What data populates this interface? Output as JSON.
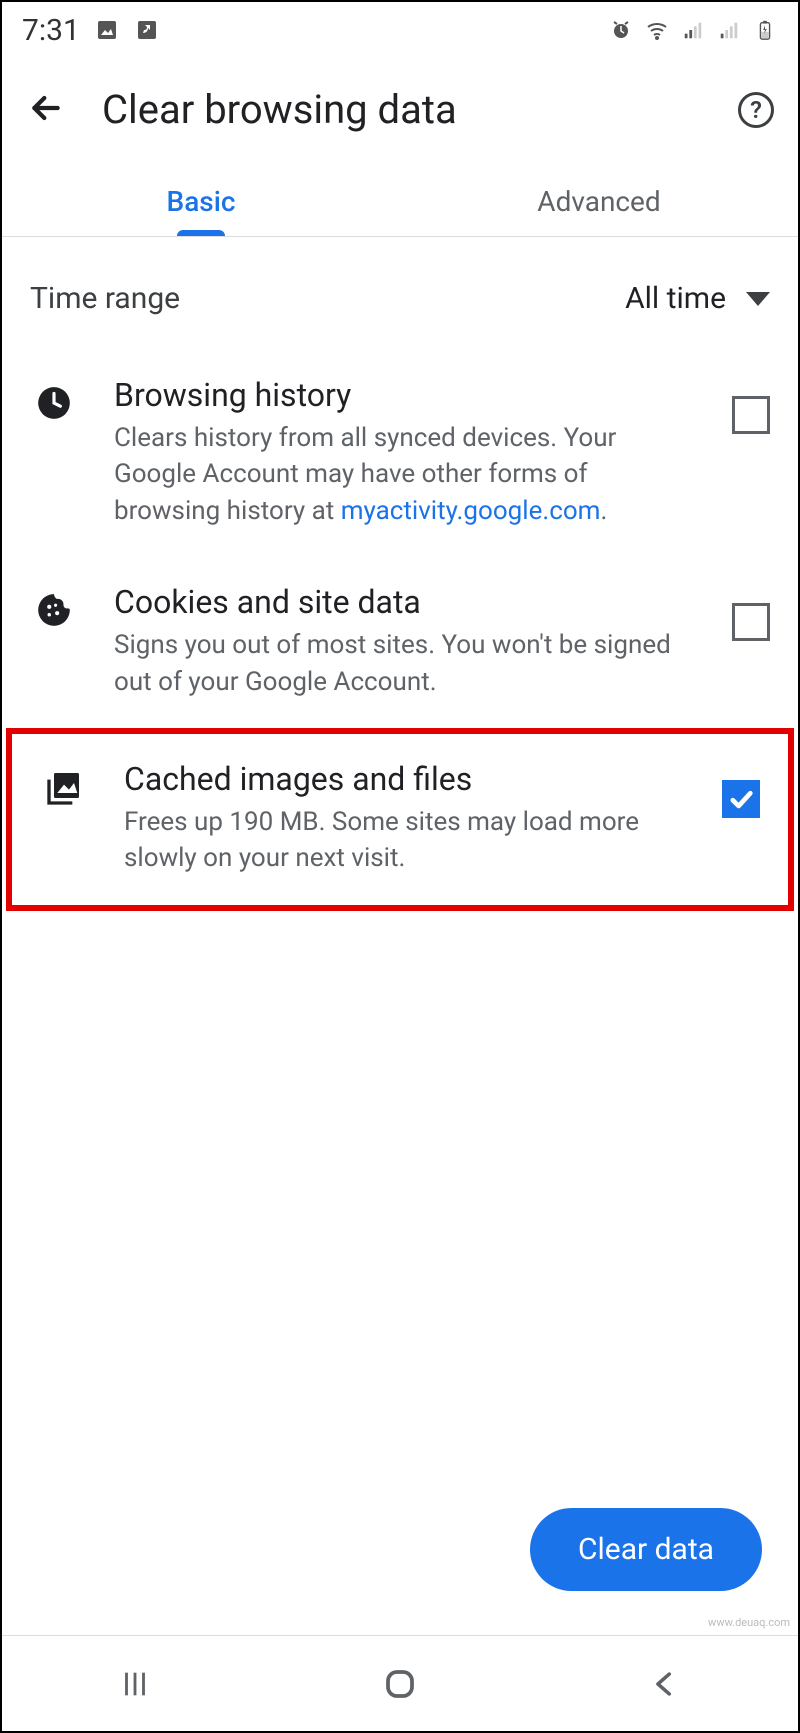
{
  "status": {
    "time": "7:31"
  },
  "header": {
    "title": "Clear browsing data"
  },
  "tabs": {
    "basic": "Basic",
    "advanced": "Advanced"
  },
  "time_range": {
    "label": "Time range",
    "value": "All time"
  },
  "items": [
    {
      "title": "Browsing history",
      "desc_pre": "Clears history from all synced devices. Your Google Account may have other forms of browsing history at ",
      "link": "myactivity.google.com",
      "desc_post": ".",
      "checked": false
    },
    {
      "title": "Cookies and site data",
      "desc": "Signs you out of most sites. You won't be signed out of your Google Account.",
      "checked": false
    },
    {
      "title": "Cached images and files",
      "desc": "Frees up 190 MB. Some sites may load more slowly on your next visit.",
      "checked": true
    }
  ],
  "action": {
    "clear": "Clear data"
  }
}
